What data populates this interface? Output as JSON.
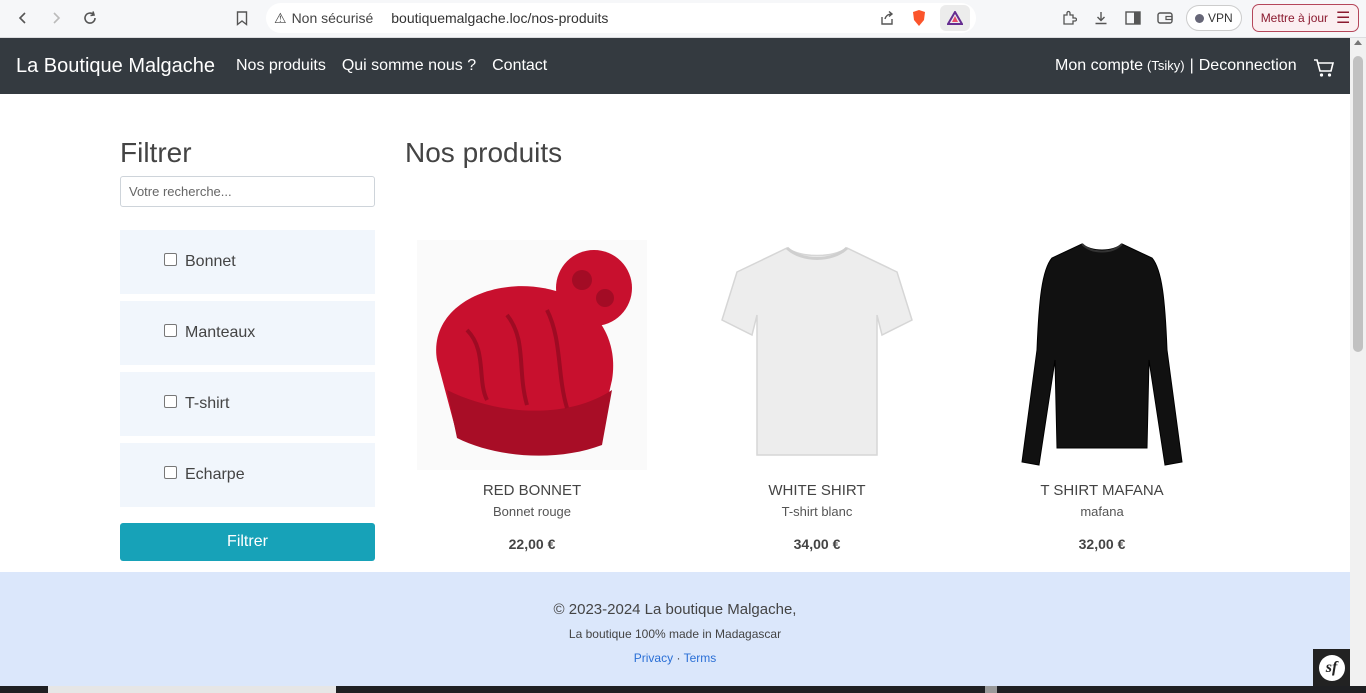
{
  "browser": {
    "security": "Non sécurisé",
    "url": "boutiquemalgache.loc/nos-produits",
    "vpn_label": "VPN",
    "update_label": "Mettre à jour"
  },
  "navbar": {
    "brand": "La Boutique Malgache",
    "links": [
      "Nos produits",
      "Qui somme nous ?",
      "Contact"
    ],
    "account_label": "Mon compte",
    "account_user": "(Tsiky)",
    "separator": "|",
    "logout_label": "Deconnection"
  },
  "sidebar": {
    "title": "Filtrer",
    "search_placeholder": "Votre recherche...",
    "categories": [
      "Bonnet",
      "Manteaux",
      "T-shirt",
      "Echarpe"
    ],
    "submit_label": "Filtrer"
  },
  "main": {
    "title": "Nos produits",
    "products": [
      {
        "name": "RED BONNET",
        "subtitle": "Bonnet rouge",
        "price": "22,00 €",
        "image": "red-bonnet-image"
      },
      {
        "name": "WHITE SHIRT",
        "subtitle": "T-shirt blanc",
        "price": "34,00 €",
        "image": "white-shirt-image"
      },
      {
        "name": "T SHIRT MAFANA",
        "subtitle": "mafana",
        "price": "32,00 €",
        "image": "black-longsleeve-image"
      }
    ]
  },
  "footer": {
    "copyright": "© 2023-2024 La boutique Malgache,",
    "tagline": "La boutique 100% made in Madagascar",
    "privacy": "Privacy",
    "dot": "·",
    "terms": "Terms"
  },
  "colors": {
    "navbar_bg": "#343a40",
    "filter_button": "#17a2b8",
    "footer_bg": "#dbe7fb",
    "category_bg": "#f1f6fc"
  }
}
